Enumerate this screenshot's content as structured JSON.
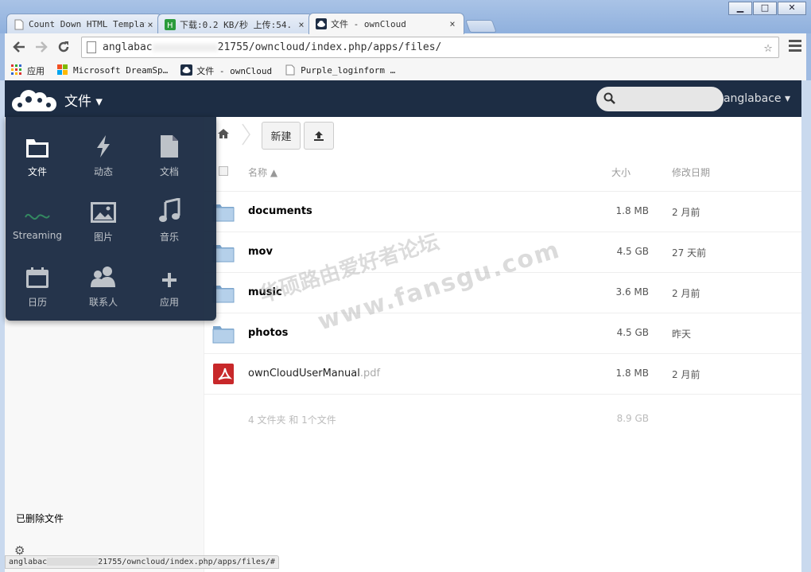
{
  "browser": {
    "tabs": [
      {
        "title": "Count Down HTML Templat",
        "close": "×"
      },
      {
        "title": "下载:0.2 KB/秒 上传:54.",
        "close": "×"
      },
      {
        "title": "文件 - ownCloud",
        "close": "×"
      }
    ],
    "url_prefix": "anglabac",
    "url_suffix": "21755/owncloud/index.php/apps/files/",
    "bookmarks": [
      {
        "label": "应用"
      },
      {
        "label": "Microsoft DreamSp…"
      },
      {
        "label": "文件 - ownCloud"
      },
      {
        "label": "Purple_loginform …"
      }
    ],
    "status_prefix": "anglabac",
    "status_suffix": "21755/owncloud/index.php/apps/files/#"
  },
  "header": {
    "app_name": "文件 ▾",
    "user": "anglabace ▾"
  },
  "app_menu": [
    {
      "label": "文件",
      "icon": "folder-icon",
      "active": true
    },
    {
      "label": "动态",
      "icon": "activity-icon",
      "active": false
    },
    {
      "label": "文档",
      "icon": "document-icon",
      "active": false
    },
    {
      "label": "Streaming",
      "icon": "streaming-icon",
      "active": false
    },
    {
      "label": "图片",
      "icon": "image-icon",
      "active": false
    },
    {
      "label": "音乐",
      "icon": "music-icon",
      "active": false
    },
    {
      "label": "日历",
      "icon": "calendar-icon",
      "active": false
    },
    {
      "label": "联系人",
      "icon": "contacts-icon",
      "active": false
    },
    {
      "label": "应用",
      "icon": "plus-icon",
      "active": false
    }
  ],
  "sidebar": {
    "deleted_files": "已删除文件"
  },
  "controls": {
    "new_label": "新建"
  },
  "table": {
    "headers": {
      "name": "名称 ▲",
      "size": "大小",
      "modified": "修改日期"
    },
    "rows": [
      {
        "name": "documents",
        "ext": "",
        "type": "folder",
        "size": "1.8 MB",
        "date": "2 月前"
      },
      {
        "name": "mov",
        "ext": "",
        "type": "folder",
        "size": "4.5 GB",
        "date": "27 天前"
      },
      {
        "name": "music",
        "ext": "",
        "type": "folder",
        "size": "3.6 MB",
        "date": "2 月前"
      },
      {
        "name": "photos",
        "ext": "",
        "type": "folder",
        "size": "4.5 GB",
        "date": "昨天"
      },
      {
        "name": "ownCloudUserManual",
        "ext": ".pdf",
        "type": "pdf",
        "size": "1.8 MB",
        "date": "2 月前"
      }
    ],
    "summary": {
      "text": "4 文件夹 和 1个文件",
      "size": "8.9 GB"
    }
  },
  "watermark": {
    "line1": "华硕路由爱好者论坛",
    "line2": "www.fansgu.com"
  }
}
